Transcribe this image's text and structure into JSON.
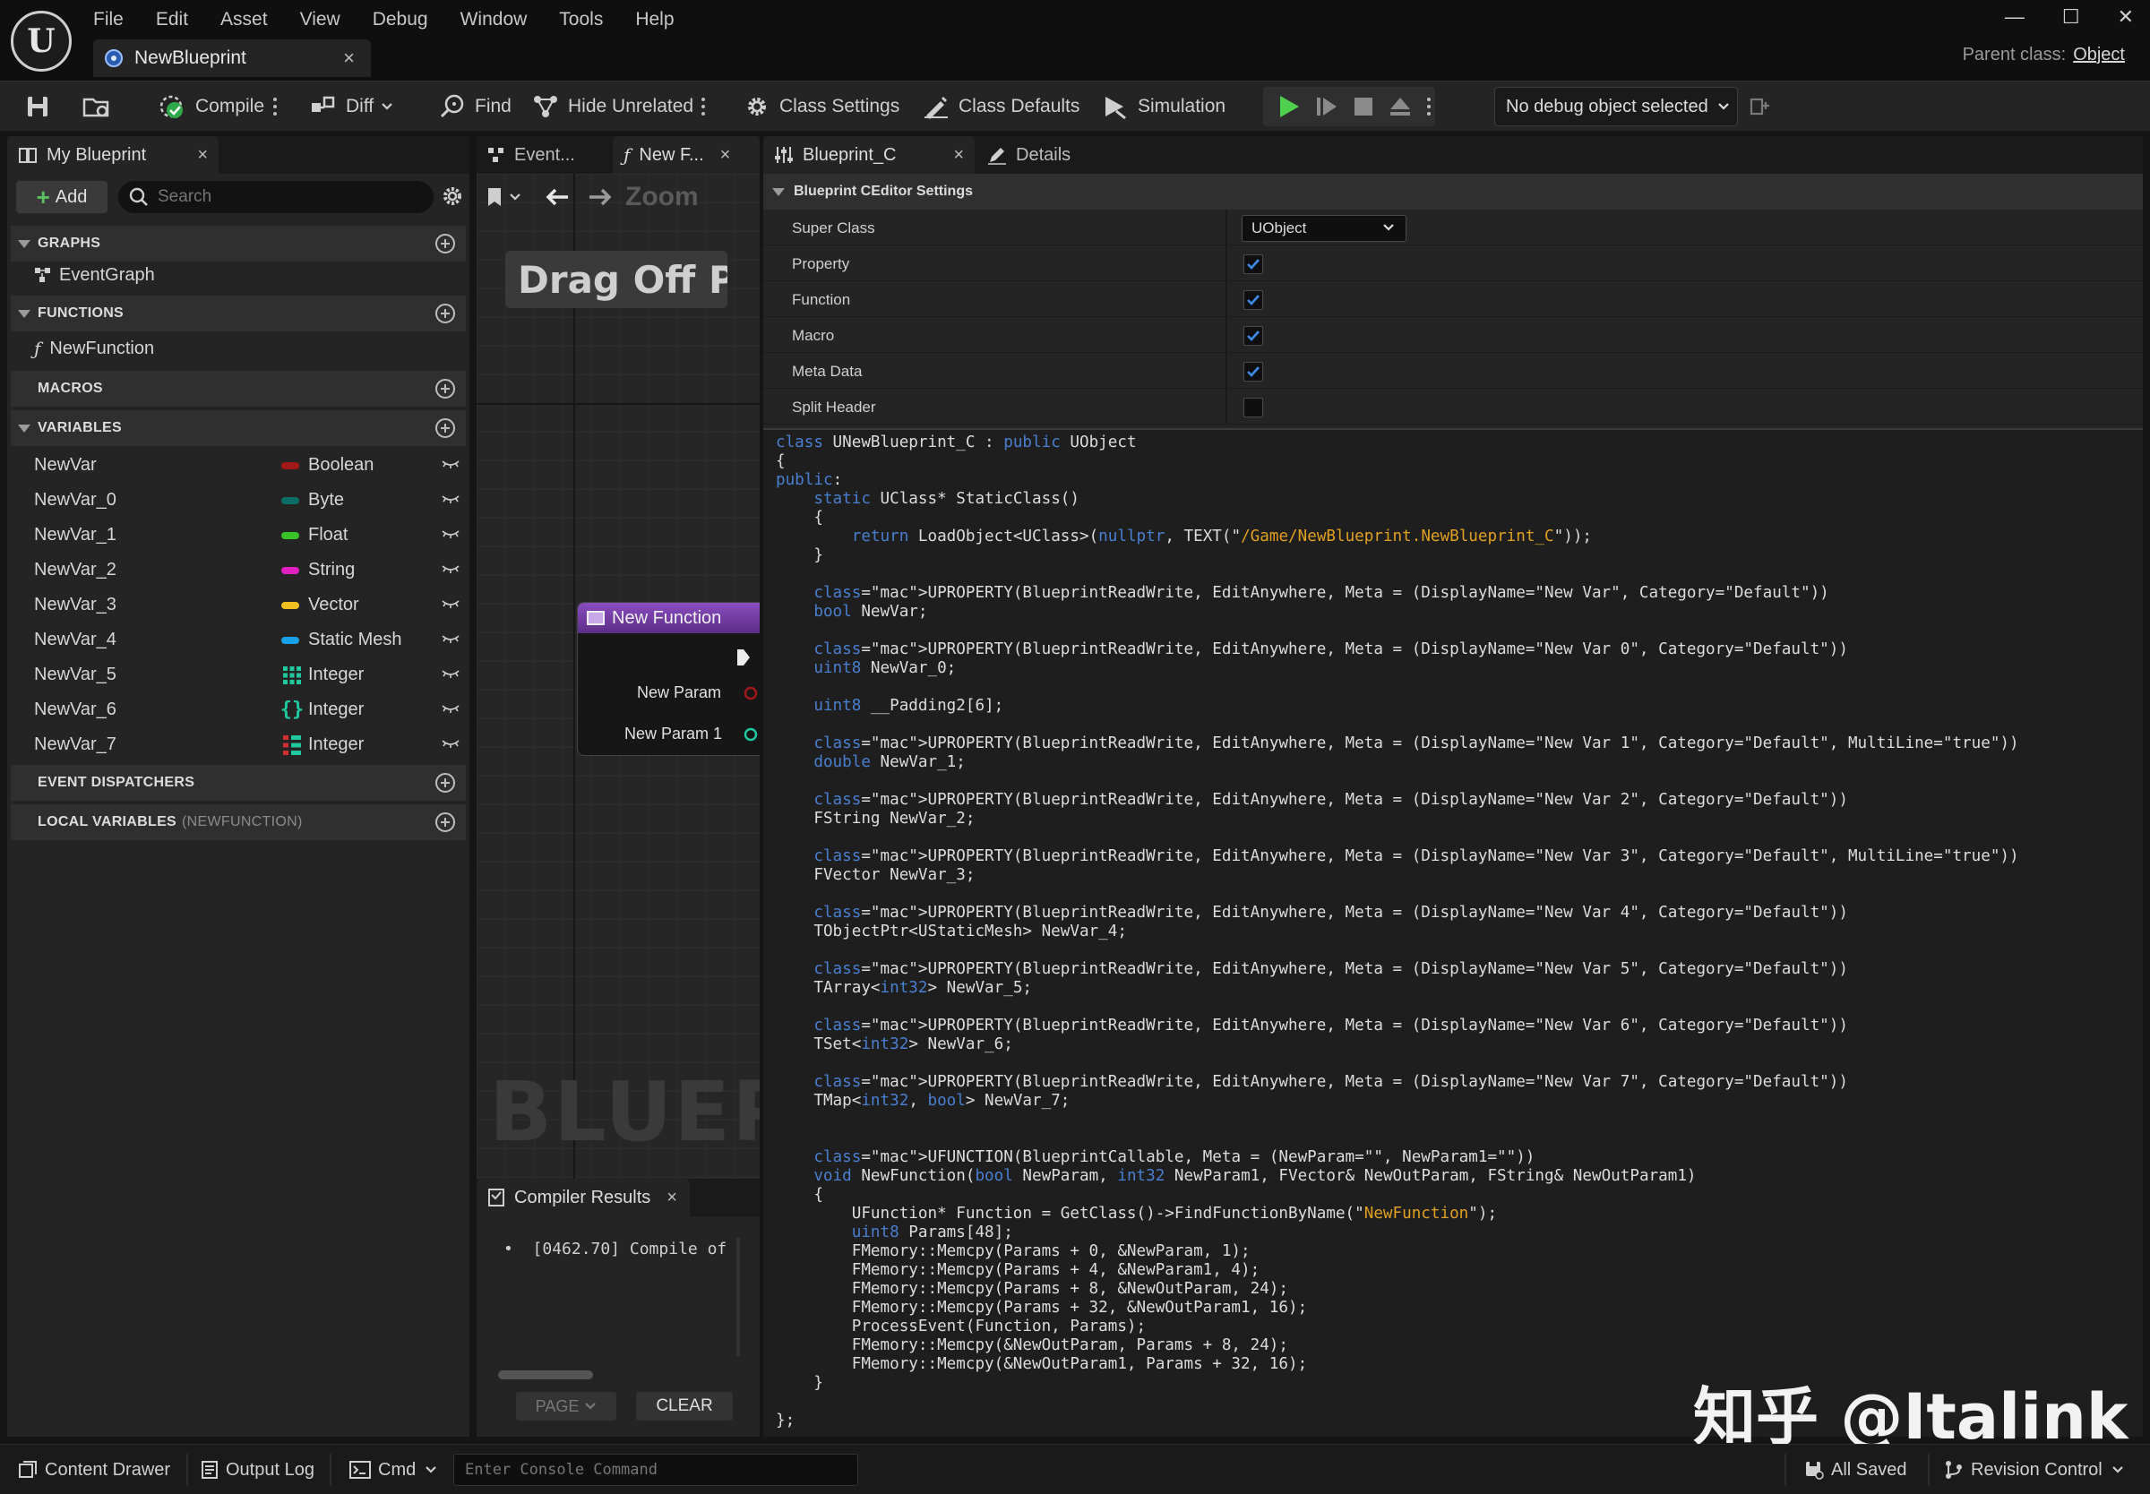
{
  "menu": [
    "File",
    "Edit",
    "Asset",
    "View",
    "Debug",
    "Window",
    "Tools",
    "Help"
  ],
  "document_tab": "NewBlueprint",
  "parent_class": {
    "label": "Parent class:",
    "value": "Object"
  },
  "toolbar": {
    "compile": "Compile",
    "diff": "Diff",
    "find": "Find",
    "hide_unrelated": "Hide Unrelated",
    "class_settings": "Class Settings",
    "class_defaults": "Class Defaults",
    "simulation": "Simulation",
    "debug_object": "No debug object selected"
  },
  "my_blueprint": {
    "tab": "My Blueprint",
    "add": "Add",
    "search_placeholder": "Search",
    "sections": {
      "graphs": "GRAPHS",
      "functions": "FUNCTIONS",
      "macros": "MACROS",
      "variables": "VARIABLES",
      "event_dispatchers": "EVENT DISPATCHERS",
      "local_variables": "LOCAL VARIABLES",
      "local_variables_scope": "(NEWFUNCTION)"
    },
    "graph_item": "EventGraph",
    "function_item": "NewFunction",
    "variables": [
      {
        "name": "NewVar",
        "type": "Boolean",
        "color": "#a01818"
      },
      {
        "name": "NewVar_0",
        "type": "Byte",
        "color": "#0a6e64"
      },
      {
        "name": "NewVar_1",
        "type": "Float",
        "color": "#38c428"
      },
      {
        "name": "NewVar_2",
        "type": "String",
        "color": "#e020c0"
      },
      {
        "name": "NewVar_3",
        "type": "Vector",
        "color": "#f0c020"
      },
      {
        "name": "NewVar_4",
        "type": "Static Mesh",
        "color": "#18a0e8"
      },
      {
        "name": "NewVar_5",
        "type": "Integer",
        "color": "#20c8a0"
      },
      {
        "name": "NewVar_6",
        "type": "Integer",
        "color": "#20c8a0"
      },
      {
        "name": "NewVar_7",
        "type": "Integer",
        "color": "#20c8a0"
      }
    ]
  },
  "graph": {
    "tabs": [
      "Event...",
      "New F..."
    ],
    "zoom_text": "Zoom",
    "drag_hint": "Drag Off Pir",
    "node_title": "New Function",
    "pin_1": "New Param",
    "pin_2": "New Param 1",
    "watermark": "BLUEPR"
  },
  "compiler": {
    "tab": "Compiler Results",
    "message": "[0462.70] Compile of",
    "page": "PAGE",
    "clear": "CLEAR"
  },
  "details": {
    "tab_1": "Blueprint_C",
    "tab_2": "Details",
    "section": "Blueprint CEditor Settings",
    "super_class_label": "Super Class",
    "super_class_value": "UObject",
    "rows": [
      {
        "label": "Property",
        "checked": true
      },
      {
        "label": "Function",
        "checked": true
      },
      {
        "label": "Macro",
        "checked": true
      },
      {
        "label": "Meta Data",
        "checked": true
      },
      {
        "label": "Split Header",
        "checked": false
      }
    ]
  },
  "code_lines": [
    "class UNewBlueprint_C : public UObject",
    "{",
    "public:",
    "    static UClass* StaticClass()",
    "    {",
    "        return LoadObject<UClass>(nullptr, TEXT(\"/Game/NewBlueprint.NewBlueprint_C\"));",
    "    }",
    "",
    "    UPROPERTY(BlueprintReadWrite, EditAnywhere, Meta = (DisplayName=\"New Var\", Category=\"Default\"))",
    "    bool NewVar;",
    "",
    "    UPROPERTY(BlueprintReadWrite, EditAnywhere, Meta = (DisplayName=\"New Var 0\", Category=\"Default\"))",
    "    uint8 NewVar_0;",
    "",
    "    uint8 __Padding2[6];",
    "",
    "    UPROPERTY(BlueprintReadWrite, EditAnywhere, Meta = (DisplayName=\"New Var 1\", Category=\"Default\", MultiLine=\"true\"))",
    "    double NewVar_1;",
    "",
    "    UPROPERTY(BlueprintReadWrite, EditAnywhere, Meta = (DisplayName=\"New Var 2\", Category=\"Default\"))",
    "    FString NewVar_2;",
    "",
    "    UPROPERTY(BlueprintReadWrite, EditAnywhere, Meta = (DisplayName=\"New Var 3\", Category=\"Default\", MultiLine=\"true\"))",
    "    FVector NewVar_3;",
    "",
    "    UPROPERTY(BlueprintReadWrite, EditAnywhere, Meta = (DisplayName=\"New Var 4\", Category=\"Default\"))",
    "    TObjectPtr<UStaticMesh> NewVar_4;",
    "",
    "    UPROPERTY(BlueprintReadWrite, EditAnywhere, Meta = (DisplayName=\"New Var 5\", Category=\"Default\"))",
    "    TArray<int32> NewVar_5;",
    "",
    "    UPROPERTY(BlueprintReadWrite, EditAnywhere, Meta = (DisplayName=\"New Var 6\", Category=\"Default\"))",
    "    TSet<int32> NewVar_6;",
    "",
    "    UPROPERTY(BlueprintReadWrite, EditAnywhere, Meta = (DisplayName=\"New Var 7\", Category=\"Default\"))",
    "    TMap<int32, bool> NewVar_7;",
    "",
    "",
    "    UFUNCTION(BlueprintCallable, Meta = (NewParam=\"\", NewParam1=\"\"))",
    "    void NewFunction(bool NewParam, int32 NewParam1, FVector& NewOutParam, FString& NewOutParam1)",
    "    {",
    "        UFunction* Function = GetClass()->FindFunctionByName(\"NewFunction\");",
    "        uint8 Params[48];",
    "        FMemory::Memcpy(Params + 0, &NewParam, 1);",
    "        FMemory::Memcpy(Params + 4, &NewParam1, 4);",
    "        FMemory::Memcpy(Params + 8, &NewOutParam, 24);",
    "        FMemory::Memcpy(Params + 32, &NewOutParam1, 16);",
    "        ProcessEvent(Function, Params);",
    "        FMemory::Memcpy(&NewOutParam, Params + 8, 24);",
    "        FMemory::Memcpy(&NewOutParam1, Params + 32, 16);",
    "    }",
    "",
    "};"
  ],
  "watermark": "知乎 @Italink",
  "statusbar": {
    "content_drawer": "Content Drawer",
    "output_log": "Output Log",
    "cmd": "Cmd",
    "console_placeholder": "Enter Console Command",
    "all_saved": "All Saved",
    "revision_control": "Revision Control"
  }
}
